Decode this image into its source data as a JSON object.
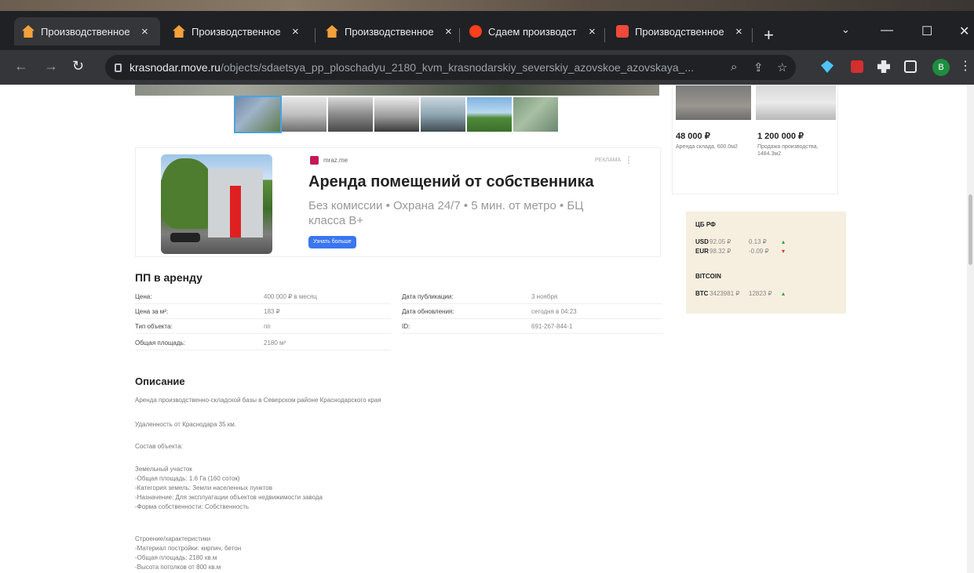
{
  "tabs": [
    {
      "title": "Производственное",
      "favicon": "house-icon",
      "active": true
    },
    {
      "title": "Производственное",
      "favicon": "house-icon",
      "active": false
    },
    {
      "title": "Производственное",
      "favicon": "house-icon",
      "active": false
    },
    {
      "title": "Сдаем производст",
      "favicon": "yandex-icon",
      "active": false
    },
    {
      "title": "Производственное",
      "favicon": "avito-icon",
      "active": false
    }
  ],
  "browser": {
    "close_glyph": "×",
    "new_tab_glyph": "+",
    "url_host": "krasnodar.move.ru",
    "url_path": "/objects/sdaetsya_pp_ploschadyu_2180_kvm_krasnodarskiy_severskiy_azovskoe_azovskaya_...",
    "profile_initial": "B"
  },
  "ad": {
    "source": "mraz.me",
    "label": "РЕКЛАМА",
    "title": "Аренда помещений от собственника",
    "subtitle": "Без комиссии • Охрана 24/7 • 5 мин. от метро • БЦ класса B+",
    "button": "Узнать больше"
  },
  "side_cards": [
    {
      "price": "48 000 ₽",
      "desc": "Аренда склада, 600.0м2"
    },
    {
      "price": "1 200 000 ₽",
      "desc": "Продажа производства, 1484.3м2"
    }
  ],
  "rates": {
    "cb_title": "ЦБ РФ",
    "rows": [
      {
        "cur": "USD",
        "val": "92.05 ₽",
        "chg": "0.13 ₽",
        "dir": "up"
      },
      {
        "cur": "EUR",
        "val": "98.32 ₽",
        "chg": "-0.09 ₽",
        "dir": "down"
      }
    ],
    "crypto_title": "BITCOIN",
    "crypto": {
      "cur": "BTC",
      "val": "3423981 ₽",
      "chg": "12823 ₽",
      "dir": "up"
    }
  },
  "listing": {
    "title": "ПП в аренду",
    "props_left": [
      {
        "k": "Цена:",
        "v": "400 000 ₽ в месяц"
      },
      {
        "k": "Цена за м²:",
        "v": "183 ₽"
      },
      {
        "k": "Тип объекта:",
        "v": "пп"
      },
      {
        "k": "Общая площадь:",
        "v": "2180 м²"
      }
    ],
    "props_right": [
      {
        "k": "Дата публикации:",
        "v": "3 ноября"
      },
      {
        "k": "Дата обновления:",
        "v": "сегодня в 04:23"
      },
      {
        "k": "ID:",
        "v": "691-267-844-1"
      }
    ]
  },
  "description": {
    "title": "Описание",
    "lines": [
      "Аренда производственно-складской базы в Северском районе Краснодарского края",
      "Удаленность от Краснодара 35 км.",
      "Состав объекта:",
      "Земельный участок",
      " -Общая площадь: 1.6 Га (160 соток)",
      " -Категория земель: Земли населенных пунктов",
      " -Назначение: Для эксплуатации объектов недвижимости завода",
      " -Форма собственности: Собственность",
      "Строение/характеристики",
      " -Материал постройки: кирпич, бетон",
      " -Общая площадь: 2180 кв.м",
      " -Высота потолков от 800 кв.м"
    ]
  }
}
